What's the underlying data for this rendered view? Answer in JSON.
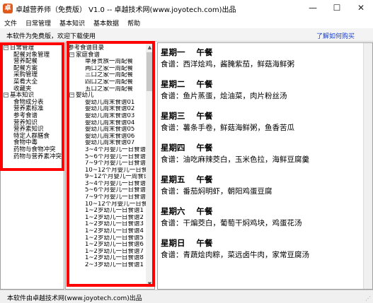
{
  "window": {
    "title": "卓越营养师（免费版） V1.0 -- 卓越技术网(www.joyotech.com)出品",
    "icon_name": "app-logo-icon",
    "minimize": "—",
    "maximize": "☐",
    "close": "✕"
  },
  "menu": [
    "文件",
    "日常管理",
    "基本知识",
    "基本数据",
    "帮助"
  ],
  "infobar": {
    "text": "本软件为免费版，欢迎下载使用",
    "link": "了解如何购买"
  },
  "left_tree": [
    {
      "label": "日常管理",
      "expander": "−",
      "children": [
        "配餐对象管理",
        "营养配餐",
        "配餐方案",
        "采购管理",
        "菜肴大全",
        "收藏夹"
      ]
    },
    {
      "label": "基本知识",
      "expander": "−",
      "children": [
        "食物成分表",
        "营养素标准",
        "参考食谱",
        "营养知识",
        "营养素知识",
        "特定人群膳食",
        "食物中毒",
        "药物与食物冲突",
        "药物与营养素冲突"
      ]
    }
  ],
  "mid_tree": {
    "root": "参考食谱目录",
    "groups": [
      {
        "label": "家庭食谱",
        "expander": "−",
        "items": [
          "单身贵族一周配餐",
          "两口之家一周配餐",
          "三口之家一周配餐",
          "四口之家一周配餐",
          "五口之家一周配餐"
        ]
      },
      {
        "label": "婴幼儿",
        "expander": "−",
        "items": [
          "婴幼儿周末食谱01",
          "婴幼儿周末食谱02",
          "婴幼儿周末食谱03",
          "婴幼儿周末食谱04",
          "婴幼儿周末食谱05",
          "婴幼儿周末食谱06",
          "婴幼儿周末食谱07",
          "3~4个月婴儿一日食谱",
          "5~6个月婴儿一日食谱",
          "7~9个月婴儿一日食谱",
          "10~12个月婴儿一日食谱",
          "9~12个月婴儿一周食谱",
          "3~4个月婴儿一日食谱",
          "5~6个月婴儿一日食谱",
          "7~9个月婴儿一日食谱",
          "10~12个月婴儿一日食谱",
          "1~2岁幼儿一日食谱1",
          "1~2岁幼儿一日食谱2",
          "1~2岁幼儿一日食谱3",
          "1~2岁幼儿一日食谱4",
          "1~2岁幼儿一日食谱5",
          "1~2岁幼儿一日食谱6",
          "1~2岁幼儿一日食谱7",
          "1~2岁幼儿一日食谱8",
          "2~3岁幼儿一日食谱1"
        ]
      }
    ]
  },
  "days": [
    {
      "day": "星期一",
      "meal": "午餐",
      "recipe": "食谱：西洋烩鸡，酱腌紫茄，鲜菇海鲜粥"
    },
    {
      "day": "星期二",
      "meal": "午餐",
      "recipe": "食谱：鱼片蒸蛋，烩油菜，肉片粉丝汤"
    },
    {
      "day": "星期三",
      "meal": "午餐",
      "recipe": "食谱：薯条手卷，鲜菇海鲜粥，鱼香苦瓜"
    },
    {
      "day": "星期四",
      "meal": "午餐",
      "recipe": "食谱：油吃麻辣茭白，玉米色拉，海鲜豆腐羹"
    },
    {
      "day": "星期五",
      "meal": "午餐",
      "recipe": "食谱：番茄焖明虾，朝阳鸡蛋豆腐"
    },
    {
      "day": "星期六",
      "meal": "午餐",
      "recipe": "食谱：干煸茭白，葡萄干焖鸡块，鸡蛋花汤"
    },
    {
      "day": "星期日",
      "meal": "午餐",
      "recipe": "食谱：青蔬烩肉粽，菜远卤牛肉，家常豆腐汤"
    }
  ],
  "status": "本软件由卓越技术网(www.joyotech.com)出品",
  "colors": {
    "highlight_box": "#ff0000",
    "link": "#1a3fcc",
    "app_icon": "#e05a1c"
  }
}
